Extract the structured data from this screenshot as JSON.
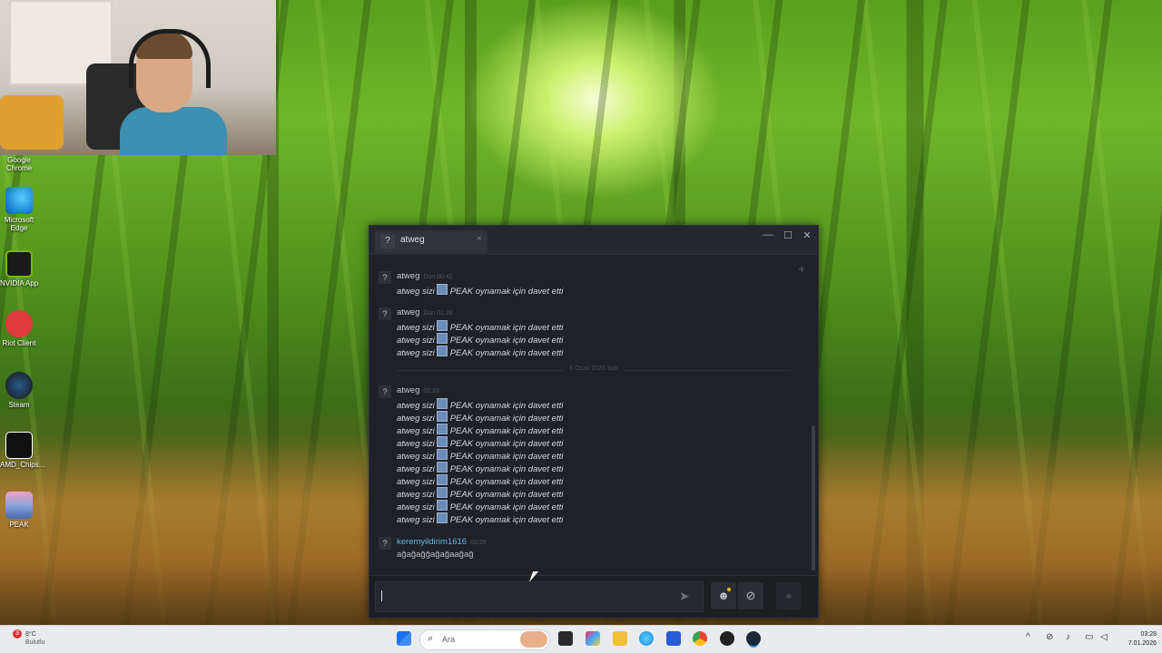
{
  "desktop": {
    "icons": [
      {
        "label": "Google\nChrome",
        "icon": "chrome-icon",
        "color": "#4285f4"
      },
      {
        "label": "Microsoft\nEdge",
        "icon": "edge-icon",
        "color": "#1f8ad6"
      },
      {
        "label": "NVIDIA App",
        "icon": "nvidia-icon",
        "color": "#76b900"
      },
      {
        "label": "Riot Client",
        "icon": "riot-icon",
        "color": "#e03a3e"
      },
      {
        "label": "Steam",
        "icon": "steam-icon",
        "color": "#1b2838"
      },
      {
        "label": "AMD_Chips...",
        "icon": "amd-icon",
        "color": "#111111"
      },
      {
        "label": "PEAK",
        "icon": "peak-icon",
        "color": "#8aa4d8"
      }
    ]
  },
  "chat": {
    "tab_title": "atweg",
    "tab_avatar": "?",
    "close_tab": "×",
    "controls": {
      "minimize": "—",
      "maximize": "☐",
      "close": "✕"
    },
    "add_friend_glyph": "+",
    "groups": [
      {
        "avatar": "?",
        "sender": "atweg",
        "time": "Dün 00:42",
        "messages": [
          "PEAK oynamak için davet etti"
        ]
      },
      {
        "avatar": "?",
        "sender": "atweg",
        "time": "Dün 01:38",
        "messages": [
          "PEAK oynamak için davet etti",
          "PEAK oynamak için davet etti",
          "PEAK oynamak için davet etti"
        ]
      },
      {
        "avatar": "?",
        "sender": "atweg",
        "time": "02:23",
        "messages": [
          "PEAK oynamak için davet etti",
          "PEAK oynamak için davet etti",
          "PEAK oynamak için davet etti",
          "PEAK oynamak için davet etti",
          "PEAK oynamak için davet etti",
          "PEAK oynamak için davet etti",
          "PEAK oynamak için davet etti",
          "PEAK oynamak için davet etti",
          "PEAK oynamak için davet etti",
          "PEAK oynamak için davet etti"
        ]
      },
      {
        "avatar": "?",
        "sender": "keremyildirim1616",
        "time": "03:28",
        "text": "ağağağğağağaağağ"
      }
    ],
    "invite_prefix": "atweg sizi",
    "day_divider": "6 Ocak 2026 Salı",
    "input_value": "",
    "send_glyph": "➤",
    "emoji_glyph": "☻",
    "attach_glyph": "⊘",
    "extra_glyph": "●"
  },
  "taskbar": {
    "weather_temp": "8°C",
    "weather_desc": "Bulutlu",
    "weather_badge": "3",
    "search_placeholder": "Ara",
    "time": "03:28",
    "date": "7.01.2026"
  }
}
